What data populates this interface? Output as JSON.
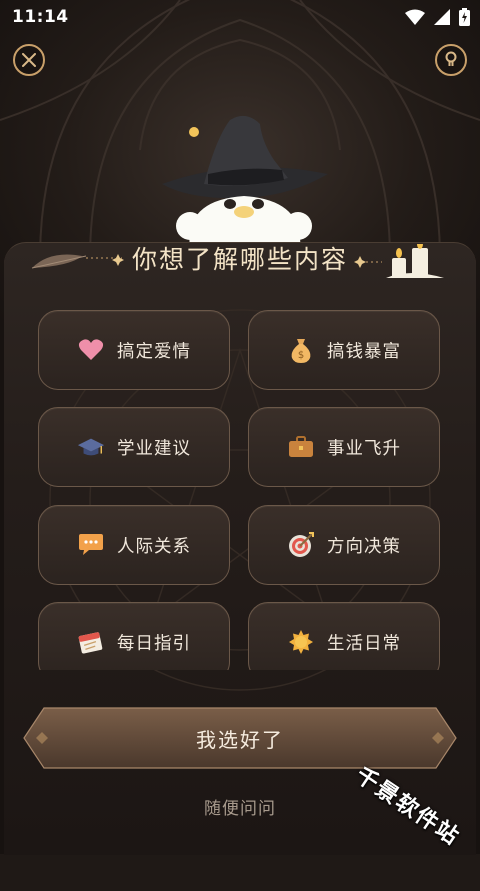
{
  "status_bar": {
    "time": "11:14"
  },
  "header": {
    "title": "你想了解哪些内容"
  },
  "options": [
    {
      "label": "搞定爱情",
      "icon": "heart-icon"
    },
    {
      "label": "搞钱暴富",
      "icon": "money-bag-icon"
    },
    {
      "label": "学业建议",
      "icon": "graduation-cap-icon"
    },
    {
      "label": "事业飞升",
      "icon": "briefcase-icon"
    },
    {
      "label": "人际关系",
      "icon": "speech-bubble-icon"
    },
    {
      "label": "方向决策",
      "icon": "target-icon"
    },
    {
      "label": "每日指引",
      "icon": "calendar-icon"
    },
    {
      "label": "生活日常",
      "icon": "sun-icon"
    }
  ],
  "confirm_button": {
    "label": "我选好了"
  },
  "random_link": {
    "label": "随便问问"
  },
  "watermark": {
    "text": "千景软件站"
  },
  "colors": {
    "accent_gold": "#c9a06a",
    "panel": "#2a221e",
    "text": "#f1e8dc"
  }
}
